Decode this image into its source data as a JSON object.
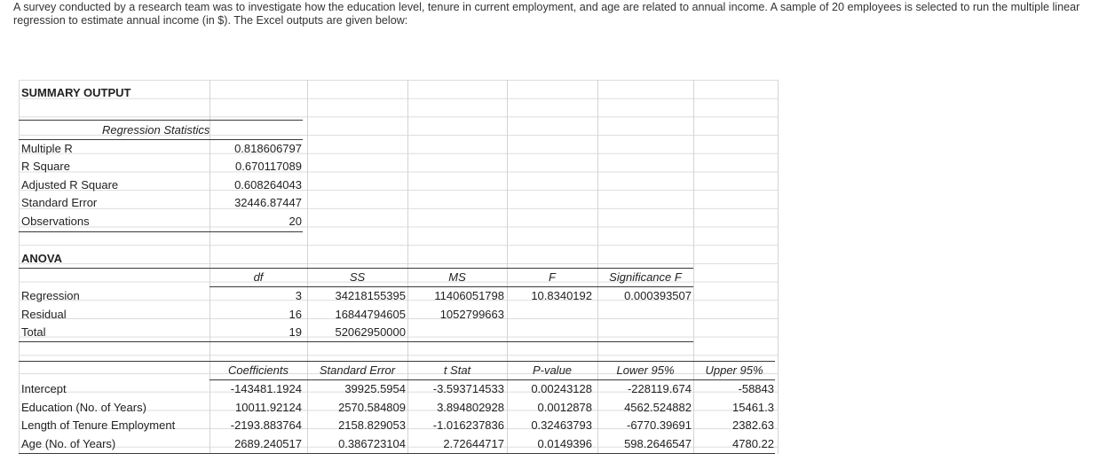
{
  "intro": "A survey conducted by a research team was to investigate how the education level, tenure in current employment, and age are related to annual income. A sample of 20 employees is selected to run the multiple linear regression to estimate annual income (in $). The Excel outputs are given below:",
  "summary_title": "SUMMARY OUTPUT",
  "regression_statistics": {
    "header": "Regression Statistics",
    "rows": [
      {
        "label": "Multiple R",
        "value": "0.818606797"
      },
      {
        "label": "R Square",
        "value": "0.670117089"
      },
      {
        "label": "Adjusted R Square",
        "value": "0.608264043"
      },
      {
        "label": "Standard Error",
        "value": "32446.87447"
      },
      {
        "label": "Observations",
        "value": "20"
      }
    ]
  },
  "anova": {
    "title": "ANOVA",
    "headers": [
      "df",
      "SS",
      "MS",
      "F",
      "Significance F"
    ],
    "rows": [
      {
        "label": "Regression",
        "df": "3",
        "ss": "34218155395",
        "ms": "11406051798",
        "f": "10.8340192",
        "sig": "0.000393507"
      },
      {
        "label": "Residual",
        "df": "16",
        "ss": "16844794605",
        "ms": "1052799663",
        "f": "",
        "sig": ""
      },
      {
        "label": "Total",
        "df": "19",
        "ss": "52062950000",
        "ms": "",
        "f": "",
        "sig": ""
      }
    ]
  },
  "coefficients": {
    "headers": [
      "Coefficients",
      "Standard Error",
      "t Stat",
      "P-value",
      "Lower 95%",
      "Upper 95%"
    ],
    "rows": [
      {
        "label": "Intercept",
        "coef": "-143481.1924",
        "se": "39925.5954",
        "t": "-3.593714533",
        "p": "0.00243128",
        "lower": "-228119.674",
        "upper": "-58843"
      },
      {
        "label": "Education (No. of Years)",
        "coef": "10011.92124",
        "se": "2570.584809",
        "t": "3.894802928",
        "p": "0.0012878",
        "lower": "4562.524882",
        "upper": "15461.3"
      },
      {
        "label": "Length of Tenure Employment",
        "coef": "-2193.883764",
        "se": "2158.829053",
        "t": "-1.016237836",
        "p": "0.32463793",
        "lower": "-6770.39691",
        "upper": "2382.63"
      },
      {
        "label": "Age (No. of Years)",
        "coef": "2689.240517",
        "se": "0.386723104",
        "t": "2.72644717",
        "p": "0.0149396",
        "lower": "598.2646547",
        "upper": "4780.22"
      }
    ]
  }
}
